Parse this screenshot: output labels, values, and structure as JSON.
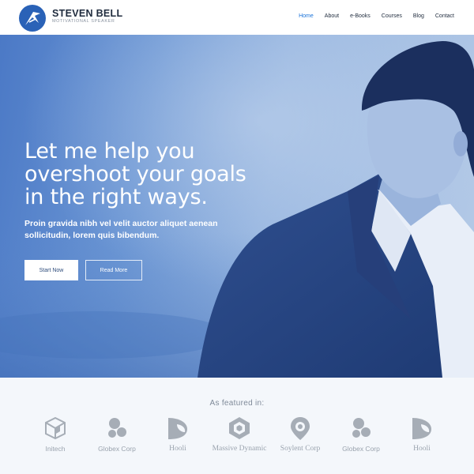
{
  "brand": {
    "name": "STEVEN BELL",
    "tagline": "MOTIVATIONAL SPEAKER",
    "accent": "#1a73d9",
    "logo_color": "#2a62b7"
  },
  "nav": [
    {
      "label": "Home",
      "active": true
    },
    {
      "label": "About"
    },
    {
      "label": "e-Books"
    },
    {
      "label": "Courses"
    },
    {
      "label": "Blog"
    },
    {
      "label": "Contact"
    }
  ],
  "hero": {
    "title_lines": [
      "Let me help you",
      "overshoot your goals",
      "in the right ways."
    ],
    "subtitle": "Proin gravida nibh vel velit auctor aliquet aenean sollicitudin, lorem quis bibendum.",
    "primary_button": "Start Now",
    "secondary_button": "Read More",
    "overlay_color": "#4b79c6"
  },
  "featured": {
    "title": "As featured in:",
    "logos": [
      {
        "name": "Initech",
        "icon": "cube-icon"
      },
      {
        "name": "Globex Corp",
        "icon": "dots-icon"
      },
      {
        "name": "Hooli",
        "icon": "leaf-icon"
      },
      {
        "name": "Massive Dynamic",
        "icon": "hexagon-icon"
      },
      {
        "name": "Soylent Corp",
        "icon": "pin-icon"
      },
      {
        "name": "Globex Corp",
        "icon": "dots-icon"
      },
      {
        "name": "Hooli",
        "icon": "leaf-icon"
      }
    ]
  }
}
